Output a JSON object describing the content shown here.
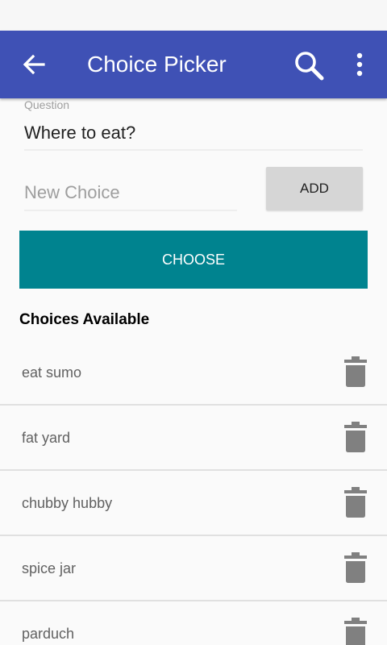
{
  "app_bar": {
    "title": "Choice Picker",
    "back_icon": "arrow-left-icon",
    "search_icon": "search-icon",
    "more_icon": "more-vert-icon",
    "color": "#3f51b5"
  },
  "form": {
    "question_label": "Question",
    "question_value": "Where to eat?",
    "new_choice_placeholder": "New Choice",
    "add_label": "ADD",
    "choose_label": "CHOOSE",
    "choose_color": "#00838f"
  },
  "choices": {
    "title": "Choices Available",
    "items": [
      {
        "label": "eat sumo"
      },
      {
        "label": "fat yard"
      },
      {
        "label": "chubby hubby"
      },
      {
        "label": "spice jar"
      },
      {
        "label": "parduch"
      }
    ],
    "delete_icon": "trash-icon"
  }
}
